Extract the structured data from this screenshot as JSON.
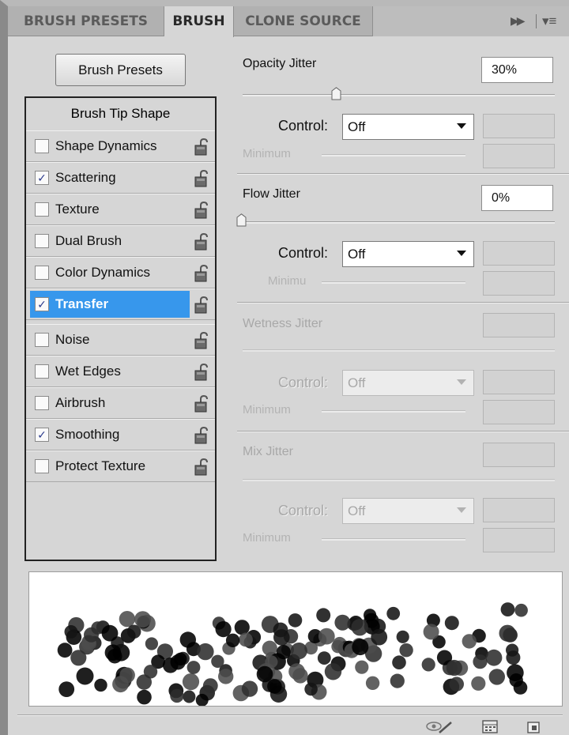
{
  "tabs": [
    {
      "label": "BRUSH PRESETS",
      "active": false
    },
    {
      "label": "BRUSH",
      "active": true
    },
    {
      "label": "CLONE SOURCE",
      "active": false
    }
  ],
  "brush_presets_button": "Brush Presets",
  "tip_list": {
    "header": "Brush Tip Shape",
    "options": [
      {
        "label": "Shape Dynamics",
        "checked": false,
        "selected": false
      },
      {
        "label": "Scattering",
        "checked": true,
        "selected": false
      },
      {
        "label": "Texture",
        "checked": false,
        "selected": false
      },
      {
        "label": "Dual Brush",
        "checked": false,
        "selected": false
      },
      {
        "label": "Color Dynamics",
        "checked": false,
        "selected": false
      },
      {
        "label": "Transfer",
        "checked": true,
        "selected": true
      },
      {
        "label": "Noise",
        "checked": false,
        "selected": false
      },
      {
        "label": "Wet Edges",
        "checked": false,
        "selected": false
      },
      {
        "label": "Airbrush",
        "checked": false,
        "selected": false
      },
      {
        "label": "Smoothing",
        "checked": true,
        "selected": false
      },
      {
        "label": "Protect Texture",
        "checked": false,
        "selected": false
      }
    ]
  },
  "opacity": {
    "label": "Opacity Jitter",
    "value": "30%",
    "control_label": "Control:",
    "control_value": "Off",
    "minimum_label": "Minimum"
  },
  "flow": {
    "label": "Flow Jitter",
    "value": "0%",
    "control_label": "Control:",
    "control_value": "Off",
    "minimum_label": "Minimu"
  },
  "wetness": {
    "label": "Wetness Jitter",
    "control_label": "Control:",
    "control_value": "Off",
    "minimum_label": "Minimum"
  },
  "mix": {
    "label": "Mix Jitter",
    "control_label": "Control:",
    "control_value": "Off",
    "minimum_label": "Minimum"
  },
  "icons": {
    "panel_forward": "double-arrow-icon",
    "panel_menu": "panel-menu-icon",
    "toggle_live_tip": "eye-brush-icon",
    "open_preset_manager": "grid-panel-icon",
    "create_new_brush": "new-brush-icon"
  },
  "colors": {
    "accent": "#3797ec",
    "panel_bg": "#d6d6d6"
  }
}
